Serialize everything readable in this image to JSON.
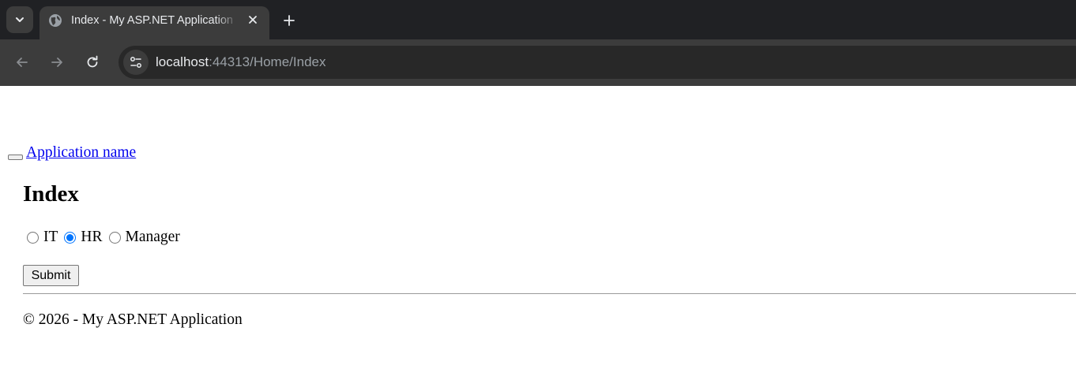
{
  "browser": {
    "tab": {
      "title": "Index - My ASP.NET Application",
      "favicon": "globe-icon"
    },
    "address_bar": {
      "host": "localhost",
      "path": ":44313/Home/Index"
    },
    "colors": {
      "tabstrip": "#202124",
      "toolbar": "#3c3c3c",
      "omnibox": "#282828"
    }
  },
  "page": {
    "brand": "Application name",
    "heading": "Index",
    "radios": [
      {
        "label": "IT",
        "checked": false
      },
      {
        "label": "HR",
        "checked": true
      },
      {
        "label": "Manager",
        "checked": false
      }
    ],
    "submit_label": "Submit",
    "footer": "© 2026 - My ASP.NET Application",
    "colors": {
      "link": "#0000ee",
      "radio_accent": "#0075ff"
    }
  }
}
